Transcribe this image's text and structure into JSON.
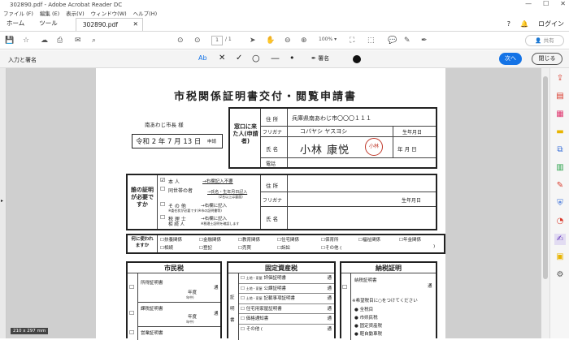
{
  "window": {
    "title": "302890.pdf - Adobe Acrobat Reader DC"
  },
  "menu": [
    "ファイル (F)",
    "編集 (E)",
    "表示(V)",
    "ウィンドウ(W)",
    "ヘルプ(H)"
  ],
  "tabs": {
    "home": "ホーム",
    "tools": "ツール",
    "document": "302890.pdf"
  },
  "header_right": {
    "login": "ログイン",
    "share": "共有"
  },
  "toolbar": {
    "page_current": "1",
    "page_total": "/ 1",
    "zoom": "100%"
  },
  "sign_bar": {
    "title": "入力と署名",
    "text_tool": "Ab",
    "sign": "署名",
    "next": "次へ",
    "close": "閉じる"
  },
  "page_size": "210 x 297 mm",
  "form": {
    "title": "市税関係証明書交付・閲覧申請書",
    "mayor": "南あわじ市長 様",
    "date": "令和 2 年  7 月 13 日",
    "date_suffix": "申請",
    "applicant_head": "窓口に来た人(申請者)",
    "lbl_address": "住 所",
    "address": "兵庫県南あわじ市〇〇〇１１１",
    "lbl_furigana": "フリガナ",
    "furigana": "コバヤシ ヤスヨシ",
    "lbl_birth": "生年月日",
    "lbl_name": "氏 名",
    "name": "小林 康悦",
    "seal": "小林",
    "birth_ymd": "年    月    日",
    "lbl_phone": "電話",
    "target_head": "誰の証明が必要ですか",
    "rel_self": "本  人",
    "rel_self_note": "→右欄記入不要",
    "rel_family": "同世帯の者",
    "rel_family_note": "→氏名・生年月日記入",
    "rel_family_sub": "(2名以上は裏面)",
    "rel_other": "そ の 他",
    "rel_other_note": "→右欄に記入",
    "rel_other_sub": "※委任状が必要です(※市の証明書等)",
    "rel_tax": "税 理 士",
    "rel_tax_note": "→右欄に記入",
    "rel_tax_sub": "※税理士証明を確認します",
    "rel_heir": "相 続 人",
    "purpose_head": "何に使われますか",
    "purposes": [
      "扶養関係",
      "金融関係",
      "教育関係",
      "住宅関係",
      "保育所",
      "福祉関係",
      "年金関係",
      "相続",
      "登記",
      "売買",
      "訴訟",
      "その他 ("
    ],
    "purpose_close": ")",
    "sec_city": "市民税",
    "city_items": [
      "所得証明書",
      "課税証明書",
      "営業証明書"
    ],
    "city_year": "年度",
    "city_avail": "年中)",
    "city_count": "通",
    "sec_asset": "固定資産税",
    "asset_side": "証明書",
    "asset_items": [
      "評価証明書",
      "公課証明書",
      "記載事項証明書",
      "住宅用家屋証明書",
      "価格通知書",
      "その他 ("
    ],
    "asset_prefix": "土地・家屋",
    "sec_pay": "納税証明",
    "pay_item": "納税証明書",
    "pay_note": "希望税目に○をつけてください",
    "pay_taxes": [
      "全税目",
      "市県民税",
      "固定資産税",
      "軽自動車税"
    ]
  }
}
